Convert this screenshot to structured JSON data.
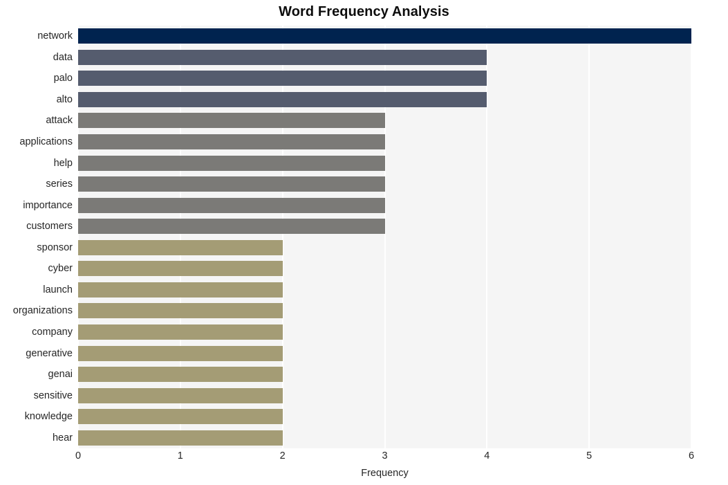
{
  "chart_data": {
    "type": "bar",
    "orientation": "horizontal",
    "title": "Word Frequency Analysis",
    "xlabel": "Frequency",
    "ylabel": "",
    "xlim": [
      0,
      6
    ],
    "xticks": [
      0,
      1,
      2,
      3,
      4,
      5,
      6
    ],
    "xtick_labels": [
      "0",
      "1",
      "2",
      "3",
      "4",
      "5",
      "6"
    ],
    "grid": true,
    "grid_axis": "x",
    "grid_color": "#ffffff",
    "plot_background": "#f5f5f5",
    "figure_background": "#ffffff",
    "legend": false,
    "categories": [
      "network",
      "data",
      "palo",
      "alto",
      "attack",
      "applications",
      "help",
      "series",
      "importance",
      "customers",
      "sponsor",
      "cyber",
      "launch",
      "organizations",
      "company",
      "generative",
      "genai",
      "sensitive",
      "knowledge",
      "hear"
    ],
    "values": [
      6,
      4,
      4,
      4,
      3,
      3,
      3,
      3,
      3,
      3,
      2,
      2,
      2,
      2,
      2,
      2,
      2,
      2,
      2,
      2
    ],
    "bar_colors": [
      "#00234f",
      "#555c6e",
      "#555c6e",
      "#555c6e",
      "#7b7a77",
      "#7b7a77",
      "#7b7a77",
      "#7b7a77",
      "#7b7a77",
      "#7b7a77",
      "#a49c75",
      "#a49c75",
      "#a49c75",
      "#a49c75",
      "#a49c75",
      "#a49c75",
      "#a49c75",
      "#a49c75",
      "#a49c75",
      "#a49c75"
    ],
    "palette": {
      "tier_6": "#00234f",
      "tier_4": "#555c6e",
      "tier_3": "#7b7a77",
      "tier_2": "#a49c75"
    }
  }
}
